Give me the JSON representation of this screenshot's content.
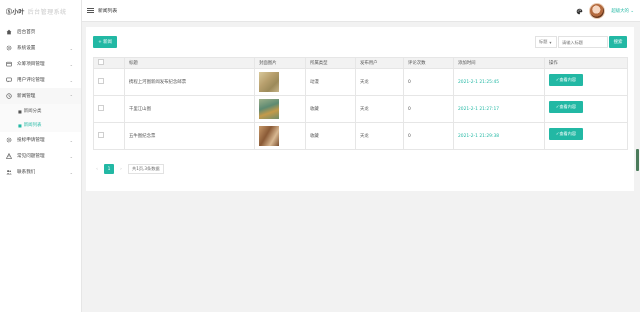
{
  "app": {
    "logo_mark": "Ⓢ小叶",
    "logo_text": "后台管理系统",
    "page_title": "新闻列表",
    "user_name": "超级大的"
  },
  "sidebar": {
    "items": [
      {
        "label": "后台首页",
        "icon": "home-icon",
        "has_children": false
      },
      {
        "label": "系统设置",
        "icon": "gear-icon",
        "has_children": true
      },
      {
        "label": "众筹项目管理",
        "icon": "folder-icon",
        "has_children": true
      },
      {
        "label": "用户评论管理",
        "icon": "comment-icon",
        "has_children": true
      },
      {
        "label": "新闻管理",
        "icon": "clock-icon",
        "has_children": true,
        "open": true
      },
      {
        "label": "投标申请管理",
        "icon": "gear-icon",
        "has_children": true
      },
      {
        "label": "常见问题管理",
        "icon": "warning-icon",
        "has_children": true
      },
      {
        "label": "联系我们",
        "icon": "users-icon",
        "has_children": true
      }
    ],
    "news_subitems": [
      {
        "label": "新闻分类",
        "active": false
      },
      {
        "label": "新闻列表",
        "active": true
      }
    ]
  },
  "toolbar": {
    "add_label": "+ 新闻",
    "select_value": "标题",
    "search_placeholder": "请输入标题",
    "search_label": "搜索"
  },
  "table": {
    "headers": [
      "",
      "标题",
      "封面图片",
      "所属类型",
      "发布用户",
      "评论次数",
      "添加时间",
      "操作"
    ],
    "rows": [
      {
        "title": "携程上河图新闻发布纪念邮票",
        "type": "动漫",
        "user": "天龙",
        "comments": "0",
        "time": "2021-2-1 21:25:45",
        "action": "✓查看内容"
      },
      {
        "title": "千里江山图",
        "type": "收藏",
        "user": "天龙",
        "comments": "0",
        "time": "2021-2-1 21:27:17",
        "action": "✓查看内容"
      },
      {
        "title": "五牛图纪念票",
        "type": "收藏",
        "user": "天龙",
        "comments": "0",
        "time": "2021-2-1 21:29:38",
        "action": "✓查看内容"
      }
    ]
  },
  "pagination": {
    "prev": "‹",
    "current": "1",
    "next": "›",
    "total": "共1页,3条数据"
  },
  "colors": {
    "accent": "#22b8a4",
    "background": "#f2f2f2",
    "panel": "#ffffff"
  }
}
